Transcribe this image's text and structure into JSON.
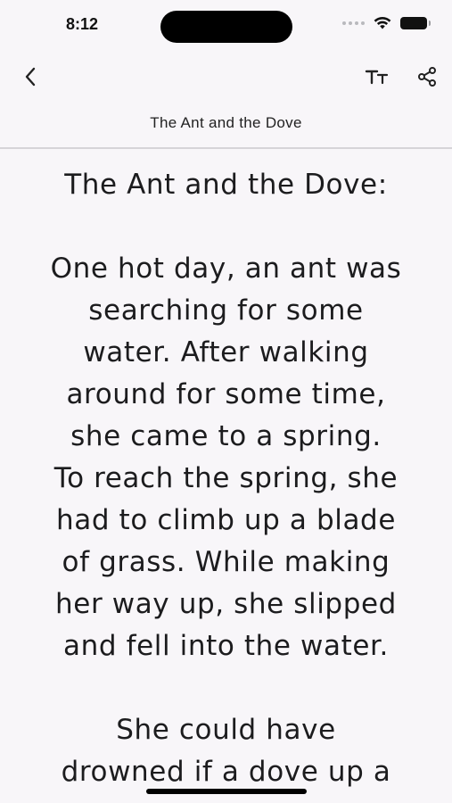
{
  "status": {
    "time": "8:12"
  },
  "nav": {
    "title": "The Ant and the Dove",
    "back_icon": "chevron-left-icon",
    "text_size_icon": "text-size-icon",
    "share_icon": "share-icon"
  },
  "story": {
    "title": "The Ant and the Dove:",
    "paragraphs": [
      {
        "lines": [
          "One hot day, an ant was",
          "searching for some",
          "water. After walking",
          "around for some time,",
          "she came to a spring.",
          "To reach the spring, she",
          "had to climb up a blade",
          "of grass. While making",
          "her way up, she slipped",
          "and fell into the water."
        ]
      },
      {
        "lines": [
          "She could have",
          "drowned if a dove up a"
        ]
      }
    ]
  }
}
